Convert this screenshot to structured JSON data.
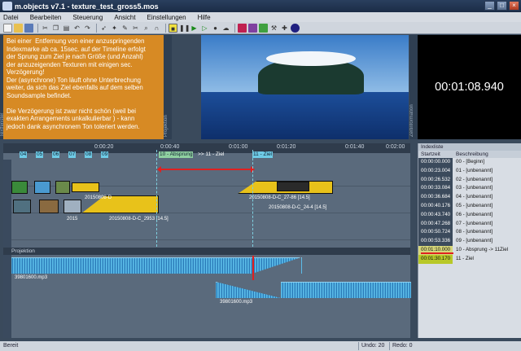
{
  "window": {
    "title": "m.objects v7.1 - texture_test_gross5.mos"
  },
  "menu": [
    "Datei",
    "Bearbeiten",
    "Steuerung",
    "Ansicht",
    "Einstellungen",
    "Hilfe"
  ],
  "text_panel": {
    "content": "Bei einer  Entfernung von einer anzuspringenden\nIndexmarke ab ca. 15sec. auf der Timeline erfolgt\nder Sprung zum Ziel je nach Größe (und Anzahl)\nder anzuzeigenden Texturen mit einigen sec.\nVerzögerung!\nDer (asynchrone) Ton läuft ohne Unterbrechung\nweiter, da sich das Ziel ebenfalls auf dem selben\nSoundsample befindet.\n\nDie Verzögerung ist zwar nicht schön (weil bei\nexakten Arrangements unkalkulierbar ) - kann\njedoch dank asynchronem Ton toleriert werden.",
    "side_label": "Textfenster"
  },
  "preview": {
    "side_label": "Projektion"
  },
  "timecode": {
    "value": "00:01:08.940",
    "side_label": "Zeitinformation"
  },
  "timeline": {
    "ruler_ticks": [
      "0:00:20",
      "0:00:40",
      "0:01:00",
      "0:01:20",
      "0:01:40",
      "0:02:00"
    ],
    "markers": [
      "04",
      "05",
      "06",
      "07",
      "08",
      "09"
    ],
    "active_marker": "10 - Absprung",
    "target_prefix": ">> 11 - Ziel",
    "target_marker": "11 - Ziel",
    "clip_labels": [
      "20150808-D",
      "20150808-D-C_2953 [14.5]",
      "20150808-D-C_27-86 [14.5]",
      "20150808-D-C_24-4 [14.5]",
      "2015"
    ]
  },
  "projection_header": "Projektion",
  "audio": {
    "tracks": [
      "39801600.mp3",
      "39801600.mp3"
    ]
  },
  "index": {
    "title": "Indexliste",
    "col_start": "Startzeit",
    "col_desc": "Beschreibung",
    "rows": [
      {
        "time": "00:00:00.000",
        "desc": "00 - [Beginn]"
      },
      {
        "time": "00:00:23.004",
        "desc": "01 - [unbenannt]"
      },
      {
        "time": "00:00:26.532",
        "desc": "02 - [unbenannt]"
      },
      {
        "time": "00:00:33.084",
        "desc": "03 - [unbenannt]"
      },
      {
        "time": "00:00:36.684",
        "desc": "04 - [unbenannt]"
      },
      {
        "time": "00:00:40.176",
        "desc": "05 - [unbenannt]"
      },
      {
        "time": "00:00:43.740",
        "desc": "06 - [unbenannt]"
      },
      {
        "time": "00:00:47.268",
        "desc": "07 - [unbenannt]"
      },
      {
        "time": "00:00:50.724",
        "desc": "08 - [unbenannt]"
      },
      {
        "time": "00:00:53.336",
        "desc": "09 - [unbenannt]"
      },
      {
        "time": "00:01:10.000",
        "desc": "10 - Absprung -> 11Ziel"
      },
      {
        "time": "00:01:30.170",
        "desc": "11 - Ziel"
      }
    ]
  },
  "status": {
    "ready": "Bereit",
    "undo": "Undo: 20",
    "redo": "Redo: 0"
  },
  "colors": {
    "text_panel_bg": "#d78a24",
    "marker": "#6ecbe6",
    "clip": "#e8c21a",
    "red_arrow": "#e02020"
  }
}
